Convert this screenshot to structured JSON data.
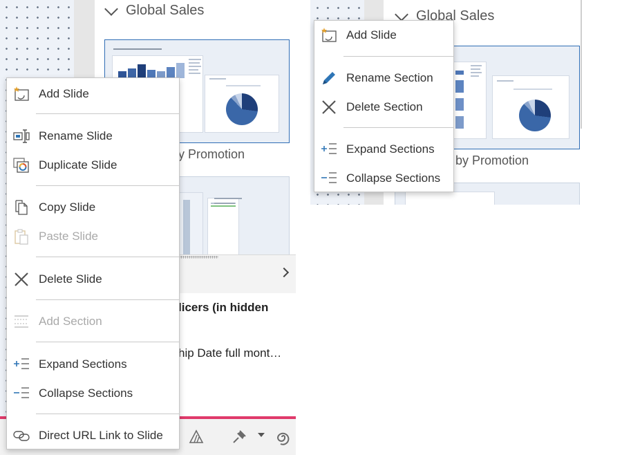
{
  "left": {
    "section_header": "Global Sales",
    "slide_caption_visible": "y Promotion",
    "detail_title": "licers (in hidden",
    "detail_subtitle": "hip Date full mont…",
    "context_menu": {
      "items": [
        {
          "label": "Add Slide",
          "icon": "add-slide-icon",
          "enabled": true
        },
        {
          "label": "Rename Slide",
          "icon": "rename-slide-icon",
          "enabled": true
        },
        {
          "label": "Duplicate Slide",
          "icon": "duplicate-slide-icon",
          "enabled": true
        },
        {
          "label": "Copy Slide",
          "icon": "copy-icon",
          "enabled": true
        },
        {
          "label": "Paste Slide",
          "icon": "paste-icon",
          "enabled": false
        },
        {
          "label": "Delete Slide",
          "icon": "delete-x-icon",
          "enabled": true
        },
        {
          "label": "Add Section",
          "icon": "add-section-icon",
          "enabled": false
        },
        {
          "label": "Expand Sections",
          "icon": "expand-sections-icon",
          "enabled": true
        },
        {
          "label": "Collapse Sections",
          "icon": "collapse-sections-icon",
          "enabled": true
        },
        {
          "label": "Direct URL Link to Slide",
          "icon": "link-icon",
          "enabled": true
        }
      ]
    }
  },
  "right": {
    "section_header": "Global Sales",
    "slide_caption_visible": "by Promotion",
    "context_menu": {
      "items": [
        {
          "label": "Add Slide",
          "icon": "add-slide-icon",
          "enabled": true
        },
        {
          "label": "Rename Section",
          "icon": "pencil-icon",
          "enabled": true
        },
        {
          "label": "Delete Section",
          "icon": "delete-x-icon",
          "enabled": true
        },
        {
          "label": "Expand Sections",
          "icon": "expand-sections-icon",
          "enabled": true
        },
        {
          "label": "Collapse Sections",
          "icon": "collapse-sections-icon",
          "enabled": true
        }
      ]
    }
  },
  "colors": {
    "accent_bar": "#e03a6b",
    "selected_border": "#2f6db5",
    "icon_blue": "#2e75b6",
    "disabled_text": "#a9a9a9"
  }
}
